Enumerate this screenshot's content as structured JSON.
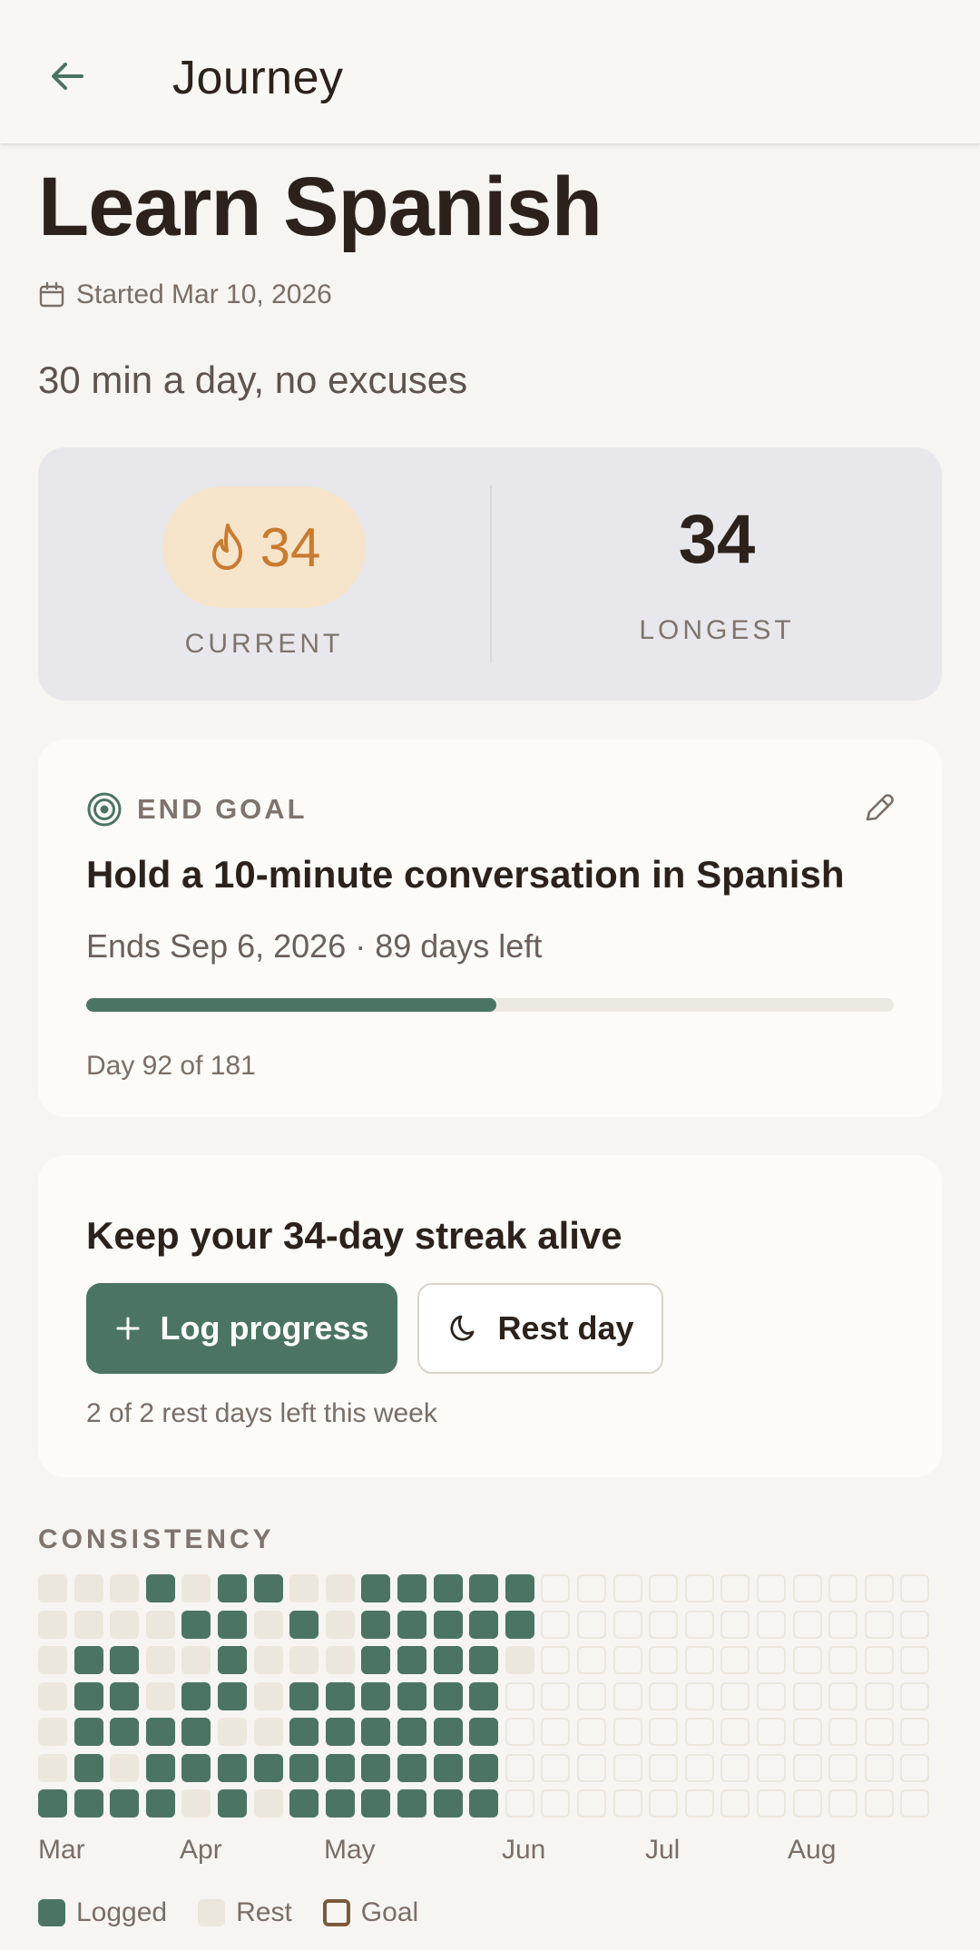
{
  "header": {
    "title": "Journey",
    "back_icon": "arrow-left-icon"
  },
  "journey": {
    "title": "Learn Spanish",
    "started": "Started Mar 10, 2026",
    "tagline": "30 min a day, no excuses"
  },
  "streak": {
    "current_value": "34",
    "current_label": "CURRENT",
    "longest_value": "34",
    "longest_label": "LONGEST"
  },
  "goal": {
    "label": "END GOAL",
    "title": "Hold a 10-minute conversation in Spanish",
    "meta": "Ends Sep 6, 2026 · 89 days left",
    "progress_fraction": 0.508,
    "progress_text": "Day 92 of 181"
  },
  "actions": {
    "title": "Keep your 34-day streak alive",
    "log_label": "Log progress",
    "rest_label": "Rest day",
    "rest_note": "2 of 2 rest days left this week"
  },
  "consistency": {
    "label": "CONSISTENCY",
    "months": [
      "Mar",
      "Apr",
      "May",
      "Jun",
      "Jul",
      "Aug"
    ],
    "grid": [
      "RRRLRLLRRLLLLLFFFFFFFFFFF",
      "RRRRLLRLRLLLLLFFFFFFFFFFF",
      "RLLRRLRRRLLLLRFFFFFFFFFFF",
      "RLLRLLRLLLLLLFFFFFFFFFFFF",
      "RLLLLRRLLLLLLFFFFFFFFFFFF",
      "RLRLLLLLLLLLLFFFFFFFFFFFF",
      "LLLLRLRLLLLLLFFFFFFFFFFFF"
    ],
    "legend": [
      {
        "label": "Logged",
        "color": "#4b7562"
      },
      {
        "label": "Rest",
        "color": "#ece7dd"
      },
      {
        "label": "Goal",
        "color": "#7a5a3c"
      }
    ]
  },
  "colors": {
    "accent": "#4b7562",
    "flame": "#c97b2f",
    "text": "#2c221b"
  }
}
